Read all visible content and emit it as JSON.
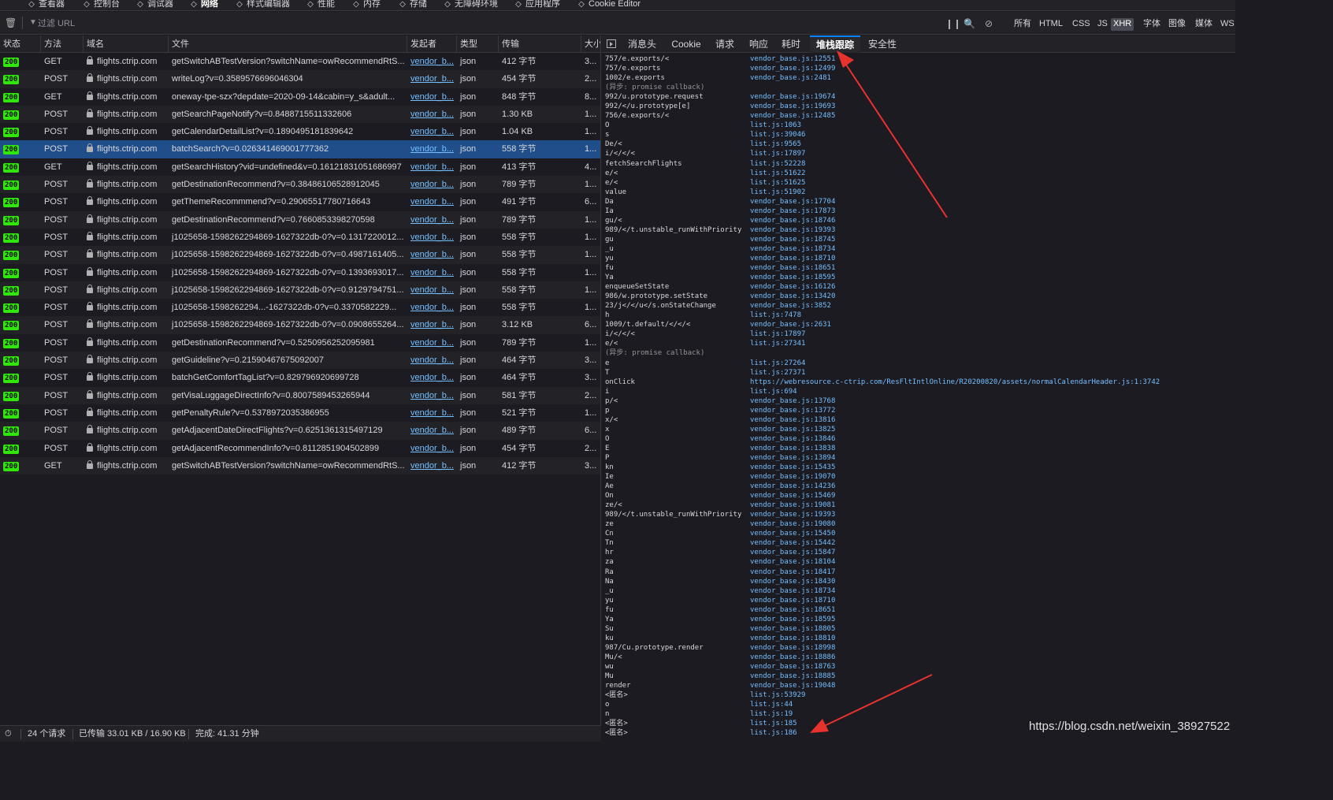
{
  "toolbar": {
    "tabs": [
      {
        "label": "查看器",
        "icon": "inspector-icon"
      },
      {
        "label": "控制台",
        "icon": "console-icon"
      },
      {
        "label": "调试器",
        "icon": "debugger-icon"
      },
      {
        "label": "网络",
        "icon": "network-icon",
        "active": true
      },
      {
        "label": "样式编辑器",
        "icon": "style-editor-icon"
      },
      {
        "label": "性能",
        "icon": "performance-icon"
      },
      {
        "label": "内存",
        "icon": "memory-icon"
      },
      {
        "label": "存储",
        "icon": "storage-icon"
      },
      {
        "label": "无障碍环境",
        "icon": "accessibility-icon"
      },
      {
        "label": "应用程序",
        "icon": "application-icon"
      },
      {
        "label": "Cookie Editor",
        "icon": "cookie-icon"
      }
    ]
  },
  "filter": {
    "placeholder": "过滤 URL",
    "types": [
      "所有",
      "HTML",
      "CSS",
      "JS",
      "XHR",
      "字体",
      "图像",
      "媒体",
      "WS"
    ],
    "active_type": "XHR"
  },
  "table": {
    "columns": [
      "状态",
      "方法",
      "域名",
      "文件",
      "发起者",
      "类型",
      "传输",
      "大小"
    ],
    "rows": [
      {
        "status": "200",
        "method": "GET",
        "domain": "flights.ctrip.com",
        "file": "getSwitchABTestVersion?switchName=owRecommendRtS...",
        "initiator": "vendor_b...",
        "type": "json",
        "transfer": "412 字节",
        "size": "3..."
      },
      {
        "status": "200",
        "method": "POST",
        "domain": "flights.ctrip.com",
        "file": "writeLog?v=0.3589576696046304",
        "initiator": "vendor_b...",
        "type": "json",
        "transfer": "454 字节",
        "size": "2..."
      },
      {
        "status": "200",
        "method": "GET",
        "domain": "flights.ctrip.com",
        "file": "oneway-tpe-szx?depdate=2020-09-14&cabin=y_s&adult...",
        "initiator": "vendor_b...",
        "type": "json",
        "transfer": "848 字节",
        "size": "8..."
      },
      {
        "status": "200",
        "method": "POST",
        "domain": "flights.ctrip.com",
        "file": "getSearchPageNotify?v=0.8488715511332606",
        "initiator": "vendor_b...",
        "type": "json",
        "transfer": "1.30 KB",
        "size": "1..."
      },
      {
        "status": "200",
        "method": "POST",
        "domain": "flights.ctrip.com",
        "file": "getCalendarDetailList?v=0.1890495181839642",
        "initiator": "vendor_b...",
        "type": "json",
        "transfer": "1.04 KB",
        "size": "1..."
      },
      {
        "status": "200",
        "method": "POST",
        "domain": "flights.ctrip.com",
        "file": "batchSearch?v=0.026341469001777362",
        "initiator": "vendor_b...",
        "type": "json",
        "transfer": "558 字节",
        "size": "1...",
        "selected": true
      },
      {
        "status": "200",
        "method": "GET",
        "domain": "flights.ctrip.com",
        "file": "getSearchHistory?vid=undefined&v=0.16121831051686997",
        "initiator": "vendor_b...",
        "type": "json",
        "transfer": "413 字节",
        "size": "4..."
      },
      {
        "status": "200",
        "method": "POST",
        "domain": "flights.ctrip.com",
        "file": "getDestinationRecommend?v=0.38486106528912045",
        "initiator": "vendor_b...",
        "type": "json",
        "transfer": "789 字节",
        "size": "1..."
      },
      {
        "status": "200",
        "method": "POST",
        "domain": "flights.ctrip.com",
        "file": "getThemeRecommmend?v=0.29065517780716643",
        "initiator": "vendor_b...",
        "type": "json",
        "transfer": "491 字节",
        "size": "6..."
      },
      {
        "status": "200",
        "method": "POST",
        "domain": "flights.ctrip.com",
        "file": "getDestinationRecommend?v=0.7660853398270598",
        "initiator": "vendor_b...",
        "type": "json",
        "transfer": "789 字节",
        "size": "1..."
      },
      {
        "status": "200",
        "method": "POST",
        "domain": "flights.ctrip.com",
        "file": "j1025658-1598262294869-1627322db-0?v=0.1317220012...",
        "initiator": "vendor_b...",
        "type": "json",
        "transfer": "558 字节",
        "size": "1..."
      },
      {
        "status": "200",
        "method": "POST",
        "domain": "flights.ctrip.com",
        "file": "j1025658-1598262294869-1627322db-0?v=0.4987161405...",
        "initiator": "vendor_b...",
        "type": "json",
        "transfer": "558 字节",
        "size": "1..."
      },
      {
        "status": "200",
        "method": "POST",
        "domain": "flights.ctrip.com",
        "file": "j1025658-1598262294869-1627322db-0?v=0.1393693017...",
        "initiator": "vendor_b...",
        "type": "json",
        "transfer": "558 字节",
        "size": "1..."
      },
      {
        "status": "200",
        "method": "POST",
        "domain": "flights.ctrip.com",
        "file": "j1025658-1598262294869-1627322db-0?v=0.9129794751...",
        "initiator": "vendor_b...",
        "type": "json",
        "transfer": "558 字节",
        "size": "1..."
      },
      {
        "status": "200",
        "method": "POST",
        "domain": "flights.ctrip.com",
        "file": "j1025658-1598262294...-1627322db-0?v=0.3370582229...",
        "initiator": "vendor_b...",
        "type": "json",
        "transfer": "558 字节",
        "size": "1..."
      },
      {
        "status": "200",
        "method": "POST",
        "domain": "flights.ctrip.com",
        "file": "j1025658-1598262294869-1627322db-0?v=0.0908655264...",
        "initiator": "vendor_b...",
        "type": "json",
        "transfer": "3.12 KB",
        "size": "6..."
      },
      {
        "status": "200",
        "method": "POST",
        "domain": "flights.ctrip.com",
        "file": "getDestinationRecommend?v=0.5250956252095981",
        "initiator": "vendor_b...",
        "type": "json",
        "transfer": "789 字节",
        "size": "1..."
      },
      {
        "status": "200",
        "method": "POST",
        "domain": "flights.ctrip.com",
        "file": "getGuideline?v=0.21590467675092007",
        "initiator": "vendor_b...",
        "type": "json",
        "transfer": "464 字节",
        "size": "3..."
      },
      {
        "status": "200",
        "method": "POST",
        "domain": "flights.ctrip.com",
        "file": "batchGetComfortTagList?v=0.829796920699728",
        "initiator": "vendor_b...",
        "type": "json",
        "transfer": "464 字节",
        "size": "3..."
      },
      {
        "status": "200",
        "method": "POST",
        "domain": "flights.ctrip.com",
        "file": "getVisaLuggageDirectInfo?v=0.8007589453265944",
        "initiator": "vendor_b...",
        "type": "json",
        "transfer": "581 字节",
        "size": "2..."
      },
      {
        "status": "200",
        "method": "POST",
        "domain": "flights.ctrip.com",
        "file": "getPenaltyRule?v=0.5378972035386955",
        "initiator": "vendor_b...",
        "type": "json",
        "transfer": "521 字节",
        "size": "1..."
      },
      {
        "status": "200",
        "method": "POST",
        "domain": "flights.ctrip.com",
        "file": "getAdjacentDateDirectFlights?v=0.6251361315497129",
        "initiator": "vendor_b...",
        "type": "json",
        "transfer": "489 字节",
        "size": "6..."
      },
      {
        "status": "200",
        "method": "POST",
        "domain": "flights.ctrip.com",
        "file": "getAdjacentRecommendInfo?v=0.8112851904502899",
        "initiator": "vendor_b...",
        "type": "json",
        "transfer": "454 字节",
        "size": "2..."
      },
      {
        "status": "200",
        "method": "GET",
        "domain": "flights.ctrip.com",
        "file": "getSwitchABTestVersion?switchName=owRecommendRtS...",
        "initiator": "vendor_b...",
        "type": "json",
        "transfer": "412 字节",
        "size": "3..."
      }
    ]
  },
  "statusbar": {
    "requests": "24 个请求",
    "transferred": "已传输 33.01 KB / 16.90 KB",
    "finish": "完成: 41.31 分钟"
  },
  "detail": {
    "tabs": [
      "消息头",
      "Cookie",
      "请求",
      "响应",
      "耗时",
      "堆栈跟踪",
      "安全性"
    ],
    "active_tab": "堆栈跟踪",
    "frames": [
      {
        "fn": "757/e.exports/<",
        "src": "vendor_base.js:12551"
      },
      {
        "fn": "757/e.exports",
        "src": "vendor_base.js:12499"
      },
      {
        "fn": "1002/e.exports",
        "src": "vendor_base.js:2481"
      },
      {
        "fn": "(异步: promise callback)",
        "src": "",
        "async": true
      },
      {
        "fn": "992/u.prototype.request",
        "src": "vendor_base.js:19674"
      },
      {
        "fn": "992/</u.prototype[e]",
        "src": "vendor_base.js:19693"
      },
      {
        "fn": "756/e.exports/<",
        "src": "vendor_base.js:12485"
      },
      {
        "fn": "O",
        "src": "list.js:1063"
      },
      {
        "fn": "s",
        "src": "list.js:39046"
      },
      {
        "fn": "De/<",
        "src": "list.js:9565"
      },
      {
        "fn": "i/</</<",
        "src": "list.js:17897"
      },
      {
        "fn": "fetchSearchFlights",
        "src": "list.js:52228"
      },
      {
        "fn": "e/<",
        "src": "list.js:51622"
      },
      {
        "fn": "e/<",
        "src": "list.js:51625"
      },
      {
        "fn": "value",
        "src": "list.js:51902"
      },
      {
        "fn": "Da",
        "src": "vendor_base.js:17704"
      },
      {
        "fn": "Ia",
        "src": "vendor_base.js:17873"
      },
      {
        "fn": "gu/<",
        "src": "vendor_base.js:18746"
      },
      {
        "fn": "989/</t.unstable_runWithPriority",
        "src": "vendor_base.js:19393"
      },
      {
        "fn": "gu",
        "src": "vendor_base.js:18745"
      },
      {
        "fn": "_u",
        "src": "vendor_base.js:18734"
      },
      {
        "fn": "yu",
        "src": "vendor_base.js:18710"
      },
      {
        "fn": "fu",
        "src": "vendor_base.js:18651"
      },
      {
        "fn": "Ya",
        "src": "vendor_base.js:18595"
      },
      {
        "fn": "enqueueSetState",
        "src": "vendor_base.js:16126"
      },
      {
        "fn": "986/w.prototype.setState",
        "src": "vendor_base.js:13420"
      },
      {
        "fn": "23/j</</u</s.onStateChange",
        "src": "vendor_base.js:3852"
      },
      {
        "fn": "h",
        "src": "list.js:7478"
      },
      {
        "fn": "1009/t.default/</</<",
        "src": "vendor_base.js:2631"
      },
      {
        "fn": "i/</</<",
        "src": "list.js:17897"
      },
      {
        "fn": "e/<",
        "src": "list.js:27341"
      },
      {
        "fn": "(异步: promise callback)",
        "src": "",
        "async": true
      },
      {
        "fn": "e",
        "src": "list.js:27264"
      },
      {
        "fn": "T",
        "src": "list.js:27371"
      },
      {
        "fn": "onClick",
        "src": "https://webresource.c-ctrip.com/ResFltIntlOnline/R20200820/assets/normalCalendarHeader.js:1:3742"
      },
      {
        "fn": "i",
        "src": "list.js:694"
      },
      {
        "fn": "p/<",
        "src": "vendor_base.js:13768"
      },
      {
        "fn": "p",
        "src": "vendor_base.js:13772"
      },
      {
        "fn": "x/<",
        "src": "vendor_base.js:13816"
      },
      {
        "fn": "x",
        "src": "vendor_base.js:13825"
      },
      {
        "fn": "O",
        "src": "vendor_base.js:13846"
      },
      {
        "fn": "E",
        "src": "vendor_base.js:13838"
      },
      {
        "fn": "P",
        "src": "vendor_base.js:13894"
      },
      {
        "fn": "kn",
        "src": "vendor_base.js:15435"
      },
      {
        "fn": "Ie",
        "src": "vendor_base.js:19070"
      },
      {
        "fn": "Ae",
        "src": "vendor_base.js:14236"
      },
      {
        "fn": "On",
        "src": "vendor_base.js:15469"
      },
      {
        "fn": "ze/<",
        "src": "vendor_base.js:19081"
      },
      {
        "fn": "989/</t.unstable_runWithPriority",
        "src": "vendor_base.js:19393"
      },
      {
        "fn": "ze",
        "src": "vendor_base.js:19080"
      },
      {
        "fn": "Cn",
        "src": "vendor_base.js:15450"
      },
      {
        "fn": "Tn",
        "src": "vendor_base.js:15442"
      },
      {
        "fn": "hr",
        "src": "vendor_base.js:15847"
      },
      {
        "fn": "za",
        "src": "vendor_base.js:18104"
      },
      {
        "fn": "Ra",
        "src": "vendor_base.js:18417"
      },
      {
        "fn": "Na",
        "src": "vendor_base.js:18430"
      },
      {
        "fn": "_u",
        "src": "vendor_base.js:18734"
      },
      {
        "fn": "yu",
        "src": "vendor_base.js:18710"
      },
      {
        "fn": "fu",
        "src": "vendor_base.js:18651"
      },
      {
        "fn": "Ya",
        "src": "vendor_base.js:18595"
      },
      {
        "fn": "Su",
        "src": "vendor_base.js:18805"
      },
      {
        "fn": "ku",
        "src": "vendor_base.js:18810"
      },
      {
        "fn": "987/Cu.prototype.render",
        "src": "vendor_base.js:18998"
      },
      {
        "fn": "Mu/<",
        "src": "vendor_base.js:18886"
      },
      {
        "fn": "wu",
        "src": "vendor_base.js:18763"
      },
      {
        "fn": "Mu",
        "src": "vendor_base.js:18885"
      },
      {
        "fn": "render",
        "src": "vendor_base.js:19048"
      },
      {
        "fn": "<匿名>",
        "src": "list.js:53929"
      },
      {
        "fn": "o",
        "src": "list.js:44"
      },
      {
        "fn": "n",
        "src": "list.js:19"
      },
      {
        "fn": "<匿名>",
        "src": "list.js:185"
      },
      {
        "fn": "<匿名>",
        "src": "list.js:186"
      }
    ]
  },
  "watermark": "https://blog.csdn.net/weixin_38927522",
  "colors": {
    "background": "#1c1b22",
    "selected_row": "#204e8a",
    "link": "#75bfff",
    "status_ok": "#30e60b",
    "annotation_arrow": "#e8322c"
  }
}
